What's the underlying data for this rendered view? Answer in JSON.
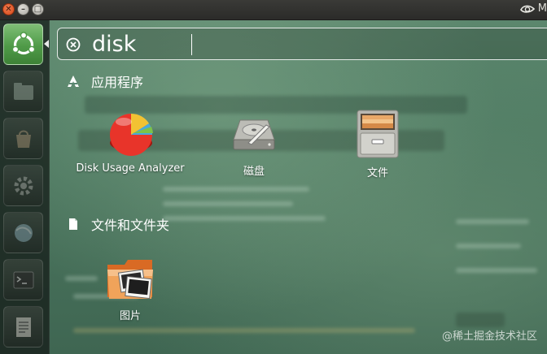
{
  "window_controls": {
    "close_glyph": "✕",
    "minimize_glyph": "–",
    "maximize_glyph": "□"
  },
  "top_panel": {
    "indicator_text": "M",
    "icons": [
      "nvidia-icon"
    ]
  },
  "launcher": {
    "items": [
      {
        "name": "ubuntu-dash-icon",
        "active": true
      },
      {
        "name": "file-manager-icon"
      },
      {
        "name": "software-center-icon"
      },
      {
        "name": "system-settings-icon"
      },
      {
        "name": "web-browser-icon"
      },
      {
        "name": "terminal-icon"
      },
      {
        "name": "text-editor-icon"
      }
    ]
  },
  "search": {
    "value": "disk",
    "clear_icon": "clear-circle-icon"
  },
  "sections": {
    "applications": {
      "title": "应用程序",
      "icon": "applications-icon",
      "results": [
        {
          "label": "Disk Usage Analyzer",
          "icon": "disk-usage-analyzer-icon"
        },
        {
          "label": "磁盘",
          "icon": "disks-icon"
        },
        {
          "label": "文件",
          "icon": "files-icon"
        }
      ]
    },
    "files_folders": {
      "title": "文件和文件夹",
      "icon": "document-icon",
      "results": [
        {
          "label": "图片",
          "icon": "pictures-folder-icon"
        }
      ]
    }
  },
  "watermark": "@稀土掘金技术社区",
  "colors": {
    "accent_green": "#4f9a48",
    "text": "#ffffff",
    "close_button": "#d64a1b"
  }
}
